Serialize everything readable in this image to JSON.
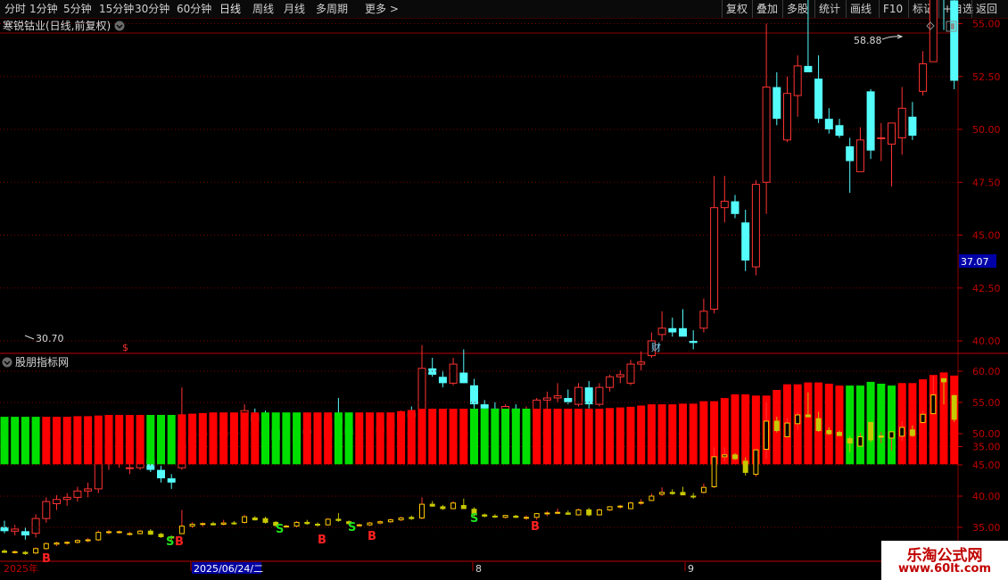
{
  "toolbar": {
    "left_items": [
      "分时",
      "1分钟",
      "5分钟",
      "15分钟",
      "30分钟",
      "60分钟",
      "日线",
      "周线",
      "月线",
      "多周期",
      "更多 >"
    ],
    "active": "日线",
    "right_items": [
      "复权",
      "叠加",
      "多股",
      "统计",
      "画线",
      "F10",
      "标记",
      "+自选",
      "返回"
    ]
  },
  "main_panel": {
    "title": "寒锐钴业(日线,前复权)",
    "high_label": "58.88",
    "low_label": "30.70",
    "current_price": "37.07",
    "y_ticks": [
      "55.00",
      "52.50",
      "50.00",
      "47.50",
      "45.00",
      "42.50",
      "40.00",
      "35.00"
    ],
    "event_markers": [
      "$",
      "财"
    ]
  },
  "indicator_panel": {
    "title": "股朋指标网",
    "y_ticks": [
      "60.00",
      "55.00",
      "50.00",
      "45.00",
      "40.00",
      "35.00"
    ],
    "signals": [
      "B",
      "S",
      "B",
      "B",
      "S",
      "B",
      "S",
      "B"
    ]
  },
  "time_axis": {
    "labels": [
      "2025年",
      "2025/06/24/二",
      "8",
      "9"
    ]
  },
  "watermark": {
    "title": "乐淘公式网",
    "url": "www.60lt.com"
  },
  "colors": {
    "up": "#ff3232",
    "down": "#54fcfc",
    "bar_red": "#ff0000",
    "bar_green": "#00e000",
    "grid": "#7a0000"
  },
  "chart_data": [
    {
      "type": "candlestick",
      "title": "寒锐钴业(日线,前复权)",
      "ylim": [
        30,
        60
      ],
      "ohlc": [
        [
          31.2,
          31.5,
          30.9,
          31.0
        ],
        [
          31.0,
          31.3,
          30.8,
          31.1
        ],
        [
          31.0,
          31.2,
          30.6,
          30.8
        ],
        [
          30.9,
          31.8,
          30.7,
          31.6
        ],
        [
          31.6,
          32.6,
          31.4,
          32.4
        ],
        [
          32.3,
          32.7,
          32.0,
          32.5
        ],
        [
          32.5,
          32.8,
          32.2,
          32.6
        ],
        [
          32.6,
          33.1,
          32.4,
          32.9
        ],
        [
          32.9,
          33.3,
          32.6,
          33.0
        ],
        [
          33.0,
          34.5,
          32.8,
          34.2
        ],
        [
          34.2,
          34.6,
          33.9,
          34.3
        ],
        [
          34.3,
          34.5,
          34.0,
          34.3
        ],
        [
          34.0,
          34.3,
          33.7,
          34.0
        ],
        [
          34.0,
          34.6,
          33.9,
          34.4
        ],
        [
          34.4,
          34.7,
          33.8,
          33.9
        ],
        [
          33.9,
          34.1,
          33.3,
          33.5
        ],
        [
          33.5,
          33.7,
          33.0,
          33.3
        ],
        [
          34.0,
          37.8,
          33.9,
          35.2
        ],
        [
          35.2,
          35.8,
          34.9,
          35.5
        ],
        [
          35.5,
          35.8,
          35.1,
          35.6
        ],
        [
          35.6,
          35.9,
          35.3,
          35.4
        ],
        [
          35.5,
          36.2,
          35.3,
          35.7
        ],
        [
          35.7,
          36.0,
          35.4,
          35.6
        ],
        [
          35.8,
          37.0,
          35.6,
          36.7
        ],
        [
          36.5,
          36.8,
          36.1,
          36.2
        ],
        [
          36.4,
          36.7,
          35.6,
          35.8
        ],
        [
          35.8,
          36.0,
          35.1,
          35.3
        ],
        [
          35.2,
          35.4,
          35.0,
          35.2
        ],
        [
          35.2,
          36.0,
          35.0,
          35.8
        ],
        [
          35.8,
          36.2,
          35.4,
          35.6
        ],
        [
          35.5,
          35.8,
          35.1,
          35.4
        ],
        [
          35.4,
          36.5,
          35.3,
          36.3
        ],
        [
          36.3,
          37.3,
          35.9,
          36.1
        ],
        [
          35.9,
          36.1,
          35.4,
          35.6
        ],
        [
          35.4,
          35.6,
          35.1,
          35.4
        ],
        [
          35.4,
          35.9,
          35.2,
          35.7
        ],
        [
          35.7,
          36.1,
          35.5,
          35.9
        ],
        [
          35.9,
          36.4,
          35.7,
          36.2
        ],
        [
          36.2,
          36.7,
          36.0,
          36.5
        ],
        [
          36.6,
          36.9,
          36.2,
          36.4
        ],
        [
          36.5,
          39.8,
          36.3,
          38.7
        ],
        [
          38.7,
          39.2,
          38.3,
          38.4
        ],
        [
          38.3,
          38.6,
          37.8,
          38.0
        ],
        [
          38.0,
          39.2,
          37.9,
          38.9
        ],
        [
          38.5,
          39.6,
          38.0,
          38.0
        ],
        [
          37.9,
          38.2,
          36.8,
          37.0
        ],
        [
          37.0,
          37.2,
          36.6,
          36.8
        ],
        [
          36.8,
          37.1,
          36.5,
          36.7
        ],
        [
          36.6,
          37.0,
          36.4,
          36.9
        ],
        [
          36.8,
          37.0,
          36.5,
          36.6
        ],
        [
          36.5,
          36.9,
          36.2,
          36.6
        ],
        [
          36.6,
          37.3,
          36.2,
          37.2
        ],
        [
          37.2,
          37.6,
          36.8,
          37.3
        ],
        [
          37.3,
          38.0,
          37.1,
          37.4
        ],
        [
          37.3,
          37.7,
          37.0,
          37.1
        ],
        [
          37.0,
          38.0,
          36.9,
          37.8
        ],
        [
          37.8,
          38.1,
          36.8,
          37.0
        ],
        [
          37.0,
          38.0,
          36.9,
          37.8
        ],
        [
          37.8,
          38.4,
          37.6,
          38.3
        ],
        [
          38.3,
          38.6,
          38.0,
          38.4
        ],
        [
          38.0,
          39.1,
          37.9,
          38.9
        ],
        [
          38.9,
          39.5,
          38.6,
          39.0
        ],
        [
          39.3,
          40.4,
          39.2,
          40.0
        ],
        [
          40.3,
          41.4,
          40.0,
          40.6
        ],
        [
          40.6,
          41.1,
          40.2,
          40.4
        ],
        [
          40.6,
          41.5,
          40.3,
          40.2
        ],
        [
          40.0,
          40.5,
          39.6,
          39.9
        ],
        [
          40.6,
          42.0,
          40.4,
          41.4
        ],
        [
          41.5,
          47.8,
          41.3,
          46.3
        ],
        [
          46.3,
          47.8,
          45.6,
          46.6
        ],
        [
          46.6,
          46.9,
          45.8,
          46.0
        ],
        [
          45.6,
          46.2,
          43.3,
          43.8
        ],
        [
          43.5,
          47.6,
          43.1,
          47.4
        ],
        [
          47.5,
          55.0,
          46.0,
          52.0
        ],
        [
          52.0,
          52.7,
          50.2,
          50.5
        ],
        [
          49.5,
          52.5,
          49.4,
          51.7
        ],
        [
          51.6,
          53.5,
          50.6,
          53.0
        ],
        [
          53.0,
          56.6,
          52.7,
          52.7
        ],
        [
          52.4,
          53.5,
          50.3,
          50.5
        ],
        [
          50.5,
          51.0,
          49.8,
          50.0
        ],
        [
          50.2,
          50.5,
          49.6,
          49.7
        ],
        [
          49.2,
          49.6,
          47.0,
          48.5
        ],
        [
          48.0,
          50.1,
          48.5,
          49.5
        ],
        [
          51.8,
          51.9,
          48.6,
          49.0
        ],
        [
          49.6,
          50.3,
          48.5,
          49.6
        ],
        [
          49.3,
          50.1,
          47.3,
          50.3
        ],
        [
          49.6,
          52.0,
          48.8,
          51.0
        ],
        [
          50.6,
          51.3,
          49.5,
          49.7
        ],
        [
          51.8,
          53.7,
          51.6,
          53.1
        ],
        [
          53.2,
          59.2,
          54.4,
          56.2
        ],
        [
          58.8,
          58.9,
          54.7,
          58.3
        ],
        [
          56.1,
          56.2,
          51.9,
          52.3
        ]
      ]
    },
    {
      "type": "bar",
      "title": "股朋指标网",
      "ylim": [
        34,
        61
      ],
      "base": 45.1,
      "bars": [
        [
          52.7,
          "g"
        ],
        [
          52.7,
          "g"
        ],
        [
          52.7,
          "g"
        ],
        [
          52.7,
          "g"
        ],
        [
          52.7,
          "r"
        ],
        [
          52.7,
          "r"
        ],
        [
          52.7,
          "r"
        ],
        [
          52.8,
          "r"
        ],
        [
          52.8,
          "r"
        ],
        [
          52.9,
          "r"
        ],
        [
          53.0,
          "r"
        ],
        [
          53.0,
          "r"
        ],
        [
          53.0,
          "r"
        ],
        [
          53.0,
          "r"
        ],
        [
          53.0,
          "g"
        ],
        [
          53.0,
          "g"
        ],
        [
          53.0,
          "g"
        ],
        [
          53.1,
          "r"
        ],
        [
          53.2,
          "r"
        ],
        [
          53.3,
          "r"
        ],
        [
          53.4,
          "r"
        ],
        [
          53.4,
          "r"
        ],
        [
          53.4,
          "r"
        ],
        [
          53.4,
          "r"
        ],
        [
          53.4,
          "r"
        ],
        [
          53.4,
          "g"
        ],
        [
          53.4,
          "g"
        ],
        [
          53.4,
          "g"
        ],
        [
          53.4,
          "g"
        ],
        [
          53.4,
          "r"
        ],
        [
          53.4,
          "r"
        ],
        [
          53.4,
          "r"
        ],
        [
          53.4,
          "g"
        ],
        [
          53.4,
          "g"
        ],
        [
          53.4,
          "r"
        ],
        [
          53.4,
          "r"
        ],
        [
          53.4,
          "r"
        ],
        [
          53.4,
          "r"
        ],
        [
          53.6,
          "r"
        ],
        [
          53.8,
          "r"
        ],
        [
          54.0,
          "r"
        ],
        [
          54.0,
          "r"
        ],
        [
          54.0,
          "r"
        ],
        [
          54.0,
          "r"
        ],
        [
          54.0,
          "r"
        ],
        [
          54.0,
          "g"
        ],
        [
          54.0,
          "g"
        ],
        [
          54.0,
          "g"
        ],
        [
          54.0,
          "g"
        ],
        [
          54.0,
          "g"
        ],
        [
          54.0,
          "g"
        ],
        [
          54.0,
          "r"
        ],
        [
          54.0,
          "r"
        ],
        [
          54.0,
          "r"
        ],
        [
          54.0,
          "r"
        ],
        [
          54.0,
          "r"
        ],
        [
          54.0,
          "r"
        ],
        [
          54.0,
          "r"
        ],
        [
          54.1,
          "r"
        ],
        [
          54.2,
          "r"
        ],
        [
          54.3,
          "r"
        ],
        [
          54.5,
          "r"
        ],
        [
          54.7,
          "r"
        ],
        [
          54.7,
          "r"
        ],
        [
          54.7,
          "r"
        ],
        [
          54.8,
          "r"
        ],
        [
          54.8,
          "r"
        ],
        [
          55.2,
          "r"
        ],
        [
          55.2,
          "r"
        ],
        [
          55.7,
          "r"
        ],
        [
          56.3,
          "r"
        ],
        [
          56.3,
          "r"
        ],
        [
          56.1,
          "r"
        ],
        [
          56.1,
          "r"
        ],
        [
          57.0,
          "r"
        ],
        [
          57.9,
          "r"
        ],
        [
          57.9,
          "r"
        ],
        [
          58.2,
          "r"
        ],
        [
          58.2,
          "r"
        ],
        [
          58.0,
          "r"
        ],
        [
          57.7,
          "r"
        ],
        [
          57.7,
          "g"
        ],
        [
          57.7,
          "g"
        ],
        [
          58.3,
          "g"
        ],
        [
          58.0,
          "g"
        ],
        [
          57.7,
          "g"
        ],
        [
          58.1,
          "r"
        ],
        [
          58.1,
          "r"
        ],
        [
          58.7,
          "r"
        ],
        [
          59.4,
          "r"
        ],
        [
          59.8,
          "r"
        ],
        [
          59.3,
          "r"
        ]
      ]
    }
  ]
}
